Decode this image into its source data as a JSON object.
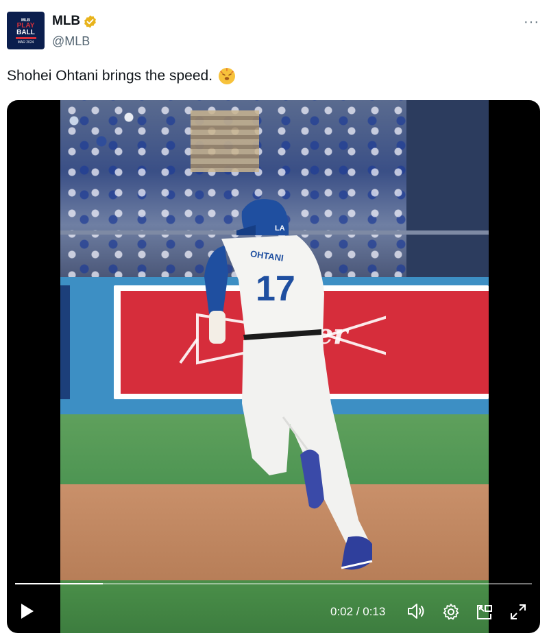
{
  "tweet": {
    "author_name": "MLB",
    "handle": "@MLB",
    "text": "Shohei Ohtani brings the speed.",
    "emoji": "hot-face-emoji",
    "more_label": "···"
  },
  "avatar": {
    "line1": "MLB",
    "line2": "PLAY",
    "line3": "BALL",
    "line4": "MAR 2024"
  },
  "video": {
    "jersey_name": "OHTANI",
    "jersey_number": "17",
    "helmet_letter": "LA",
    "ad_brand": "Budweiser",
    "ad_visible_text": "weiser",
    "current_time": "0:02",
    "duration": "0:13",
    "time_display": "0:02 / 0:13",
    "progress_fraction": 0.17
  },
  "controls": {
    "play": "play-icon",
    "volume": "volume-icon",
    "settings": "gear-icon",
    "pip": "picture-in-picture-icon",
    "fullscreen": "fullscreen-icon"
  },
  "colors": {
    "verified": "#e8b31b",
    "handle_text": "#536471",
    "dodger_blue": "#1f4fa0",
    "ad_red": "#d62d3b"
  }
}
